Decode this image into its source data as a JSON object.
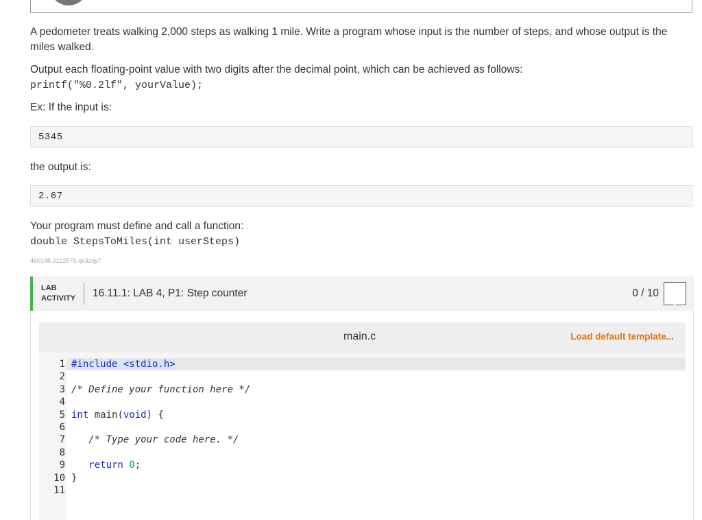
{
  "prompt": {
    "line1": "A pedometer treats walking 2,000 steps as walking 1 mile. Write a program whose input is the number of steps, and whose output is the",
    "line2": "miles walked.",
    "format_note": "Output each floating-point value with two digits after the decimal point, which can be achieved as follows:",
    "format_code": "printf(\"%0.2lf\", yourValue);",
    "example_intro": "Ex: If the input is:",
    "example_input": "5345",
    "output_intro": "the output is:",
    "example_output": "2.67",
    "function_note": "Your program must define and call a function:",
    "function_signature": "double StepsToMiles(int userSteps)",
    "activity_id": "460148.3122576.qx3zqy7"
  },
  "lab": {
    "tag_line1": "LAB",
    "tag_line2": "ACTIVITY",
    "title": "16.11.1: LAB 4, P1: Step counter",
    "score": "0 / 10",
    "accent_color": "#4caf50"
  },
  "editor": {
    "file_name": "main.c",
    "load_template_label": "Load default template...",
    "link_color": "#e8730b",
    "line_numbers": [
      "1",
      "2",
      "3",
      "4",
      "5",
      "6",
      "7",
      "8",
      "9",
      "10",
      "11"
    ],
    "lines": {
      "l1_pp": "#include <stdio.h>",
      "l3_comment": "/* Define your function here */",
      "l5_type": "int",
      "l5_rest": " main(",
      "l5_void": "void",
      "l5_end": ") {",
      "l7_comment": "   /* Type your code here. */",
      "l9_ret": "   return",
      "l9_num": "0",
      "l9_end": ";",
      "l10": "}"
    }
  }
}
